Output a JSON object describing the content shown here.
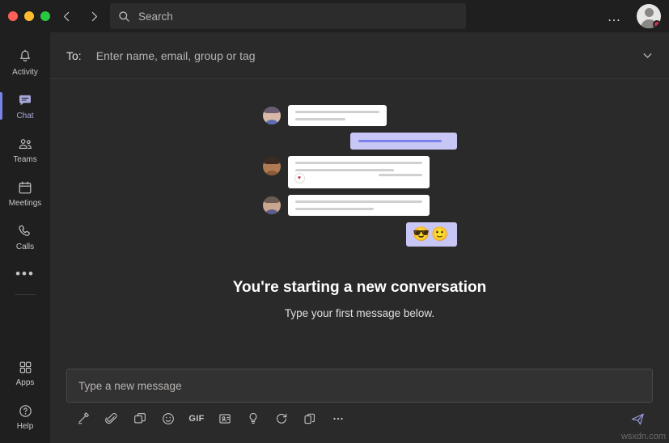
{
  "window": {
    "traffic_lights": [
      "close",
      "minimize",
      "maximize"
    ],
    "back_label": "Back",
    "forward_label": "Forward",
    "more_label": "…",
    "watermark": "wsxdn.com"
  },
  "search": {
    "placeholder": "Search",
    "icon": "search-icon"
  },
  "profile": {
    "presence_color": "#c4314b",
    "presence_label": "Busy"
  },
  "rail": {
    "items": [
      {
        "label": "Activity",
        "icon": "bell-icon",
        "active": false
      },
      {
        "label": "Chat",
        "icon": "chat-icon",
        "active": true
      },
      {
        "label": "Teams",
        "icon": "teams-icon",
        "active": false
      },
      {
        "label": "Meetings",
        "icon": "calendar-icon",
        "active": false
      },
      {
        "label": "Calls",
        "icon": "phone-icon",
        "active": false
      }
    ],
    "more_label": "•••",
    "bottom": [
      {
        "label": "Apps",
        "icon": "apps-icon"
      },
      {
        "label": "Help",
        "icon": "help-icon"
      }
    ]
  },
  "compose_header": {
    "to_label": "To:",
    "to_placeholder": "Enter name, email, group or tag",
    "expand_icon": "chevron-down-icon"
  },
  "empty_state": {
    "headline": "You're starting a new conversation",
    "subline": "Type your first message below.",
    "illustration": {
      "bubbles": [
        {
          "side": "left",
          "avatar": "a1",
          "lines": [
            100,
            60
          ],
          "style": "white"
        },
        {
          "side": "right",
          "avatar": null,
          "lines": [
            92
          ],
          "style": "purple"
        },
        {
          "side": "left",
          "avatar": "a2",
          "lines": [
            100,
            78,
            55
          ],
          "style": "white",
          "reaction": "heart"
        },
        {
          "side": "left",
          "avatar": "a3",
          "lines": [
            100,
            62
          ],
          "style": "white"
        }
      ],
      "emoji_bubble": [
        "😎",
        "🙂"
      ]
    }
  },
  "composer": {
    "placeholder": "Type a new message",
    "tools": [
      {
        "name": "format-icon",
        "label": "Format"
      },
      {
        "name": "attach-icon",
        "label": "Attach"
      },
      {
        "name": "sticker-icon",
        "label": "Sticker"
      },
      {
        "name": "emoji-icon",
        "label": "Emoji"
      },
      {
        "name": "gif-icon",
        "label": "GIF"
      },
      {
        "name": "meme-icon",
        "label": "Meme"
      },
      {
        "name": "praise-icon",
        "label": "Praise"
      },
      {
        "name": "loop-icon",
        "label": "Schedule"
      },
      {
        "name": "apps-icon",
        "label": "Apps"
      },
      {
        "name": "more-options-icon",
        "label": "More options"
      }
    ],
    "gif_label": "GIF",
    "send_label": "Send",
    "send_icon": "send-icon"
  },
  "colors": {
    "accent": "#7b83eb",
    "accent_light": "#c8c6f5",
    "app_bg": "#201f1f",
    "main_bg": "#2b2a2a",
    "busy": "#c4314b"
  }
}
